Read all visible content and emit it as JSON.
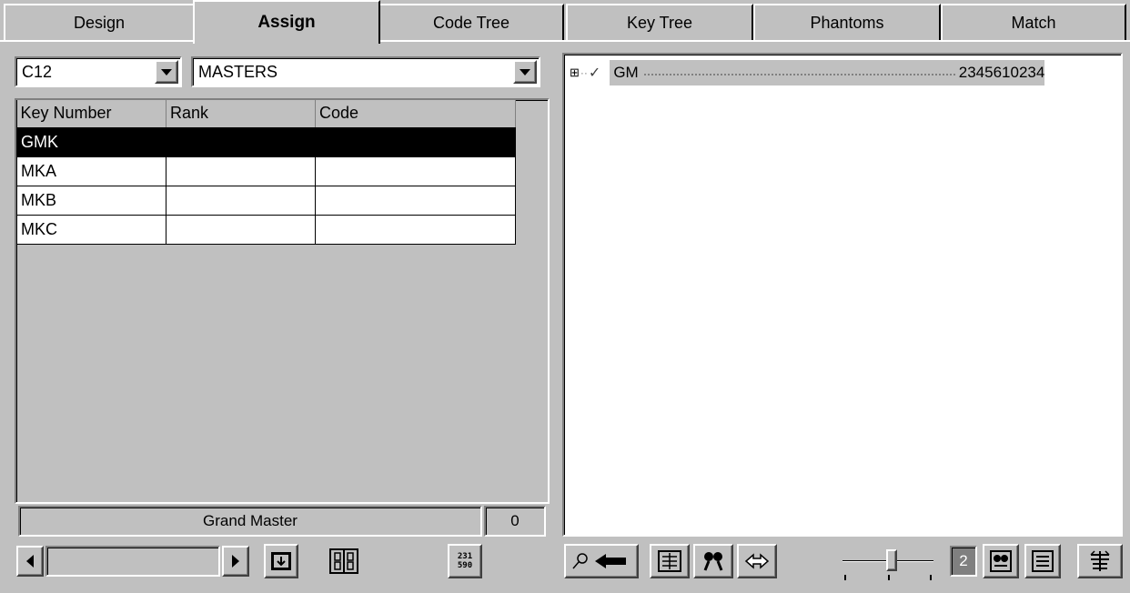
{
  "tabs": [
    {
      "label": "Design"
    },
    {
      "label": "Assign"
    },
    {
      "label": "Code Tree"
    },
    {
      "label": "Key Tree"
    },
    {
      "label": "Phantoms"
    },
    {
      "label": "Match"
    }
  ],
  "active_tab": "Assign",
  "left": {
    "system_combo": {
      "value": "C12"
    },
    "level_combo": {
      "value": "MASTERS"
    },
    "grid": {
      "columns": [
        "Key Number",
        "Rank",
        "Code"
      ],
      "rows": [
        {
          "key": "GMK",
          "rank": "",
          "code": "",
          "selected": true
        },
        {
          "key": "MKA",
          "rank": "",
          "code": ""
        },
        {
          "key": "MKB",
          "rank": "",
          "code": ""
        },
        {
          "key": "MKC",
          "rank": "",
          "code": ""
        }
      ]
    },
    "status": {
      "label": "Grand Master",
      "count": "0"
    },
    "toolbar": {
      "counter_icon_text_top": "231",
      "counter_icon_text_bottom": "590"
    }
  },
  "right": {
    "tree": {
      "root": {
        "expander": "⊞",
        "check": "✓",
        "label": "GM",
        "code": "2345610234"
      }
    },
    "toolbar": {
      "level_value": "2"
    }
  },
  "colors": {
    "face": "#c0c0c0",
    "highlight": "#ffffff",
    "shadow": "#808080",
    "selected_row": "#000000"
  }
}
